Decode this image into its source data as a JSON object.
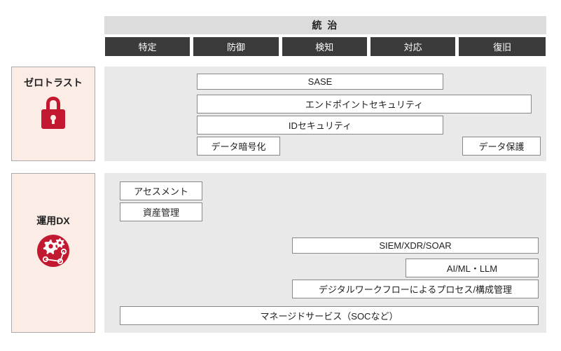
{
  "header": {
    "governance": "統 治",
    "phases": [
      "特定",
      "防御",
      "検知",
      "対応",
      "復旧"
    ]
  },
  "categories": {
    "zero_trust": "ゼロトラスト",
    "ops_dx": "運用DX"
  },
  "caps": {
    "sase": "SASE",
    "endpoint": "エンドポイントセキュリティ",
    "id_sec": "IDセキュリティ",
    "data_enc": "データ暗号化",
    "data_prot": "データ保護",
    "assessment": "アセスメント",
    "asset_mgmt": "資産管理",
    "siem": "SIEM/XDR/SOAR",
    "ai_ml": "AI/ML・LLM",
    "workflow": "デジタルワークフローによるプロセス/構成管理",
    "managed": "マネージドサービス（SOCなど）"
  }
}
